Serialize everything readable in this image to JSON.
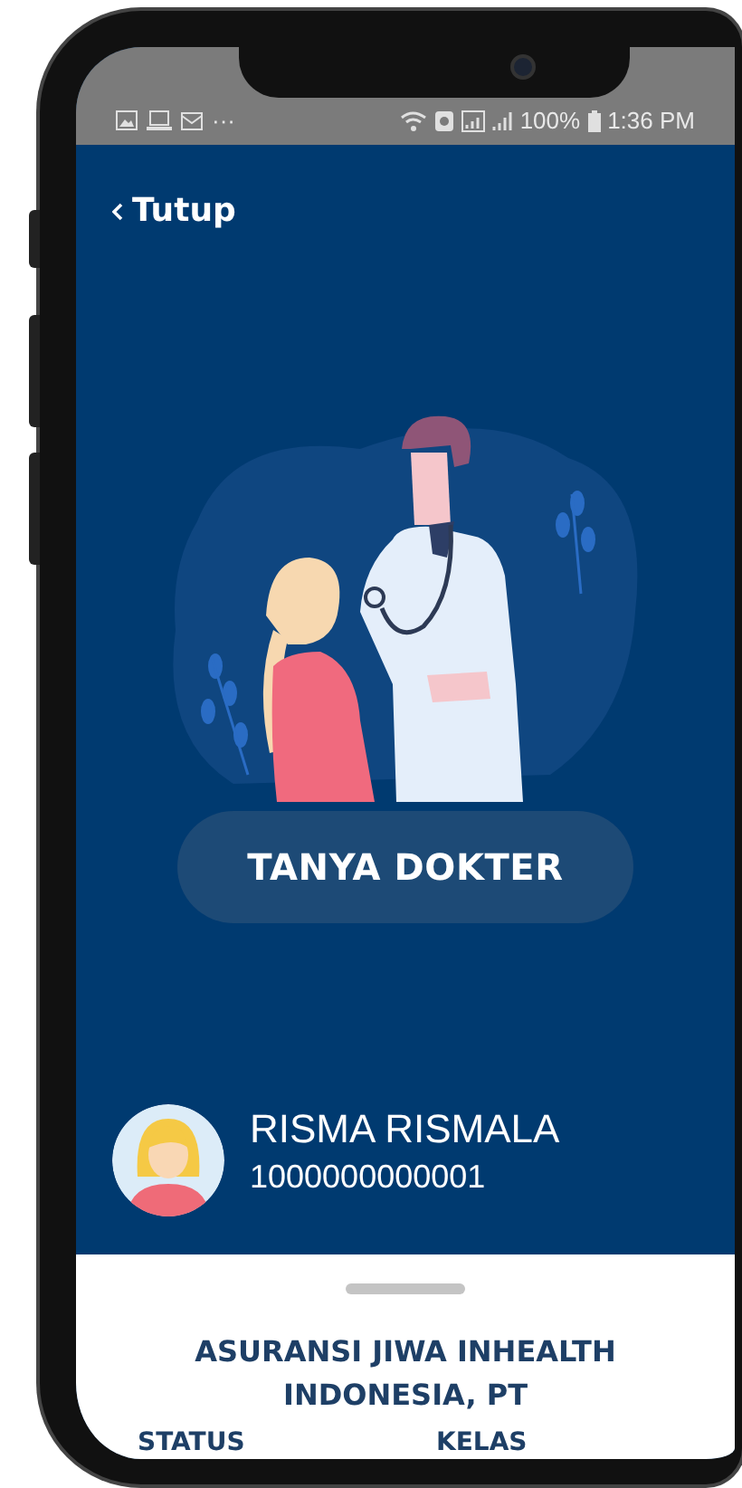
{
  "status_bar": {
    "overflow": "···",
    "battery": "100%",
    "time": "1:36 PM"
  },
  "header": {
    "close_link": "Tutup"
  },
  "hero": {
    "action_button": "TANYA DOKTER"
  },
  "member": {
    "name": "RISMA RISMALA",
    "number": "1000000000001"
  },
  "sheet": {
    "company": "ASURANSI JIWA INHEALTH INDONESIA, PT",
    "fields": [
      {
        "label": "STATUS"
      },
      {
        "label": "KELAS"
      }
    ]
  }
}
